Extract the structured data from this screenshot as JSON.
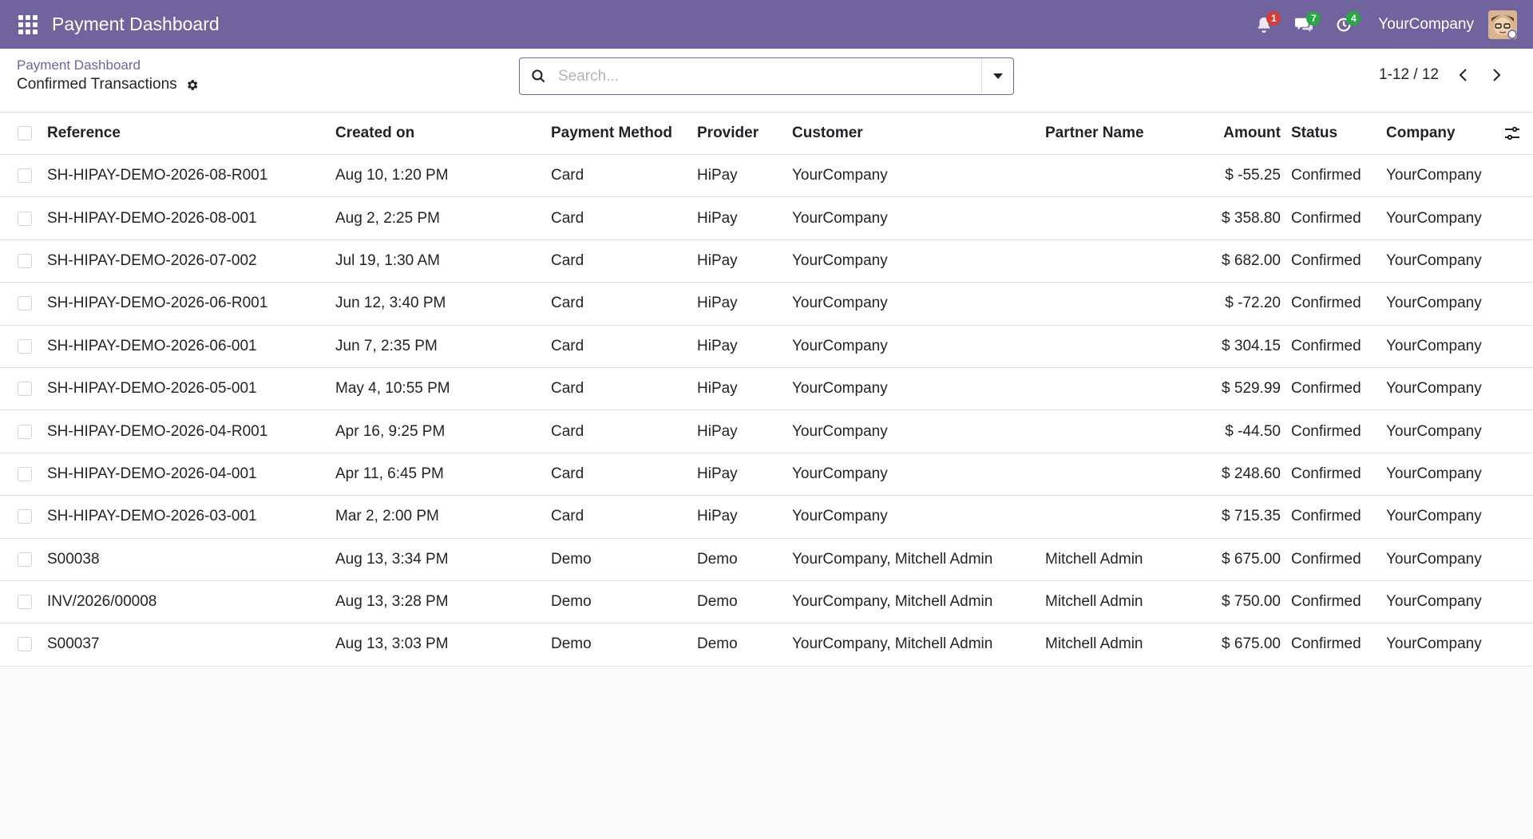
{
  "navbar": {
    "app_title": "Payment Dashboard",
    "notifications_count": "1",
    "messages_count": "7",
    "activities_count": "4",
    "company": "YourCompany"
  },
  "control_panel": {
    "breadcrumb": "Payment Dashboard",
    "title": "Confirmed Transactions",
    "search_placeholder": "Search...",
    "pager": "1-12 / 12"
  },
  "table": {
    "columns": {
      "reference": "Reference",
      "created_on": "Created on",
      "payment_method": "Payment Method",
      "provider": "Provider",
      "customer": "Customer",
      "partner_name": "Partner Name",
      "amount": "Amount",
      "status": "Status",
      "company": "Company"
    },
    "rows": [
      {
        "reference": "SH-HIPAY-DEMO-2026-08-R001",
        "created_on": "Aug 10, 1:20 PM",
        "payment_method": "Card",
        "provider": "HiPay",
        "customer": "YourCompany",
        "partner_name": "",
        "amount": "$ -55.25",
        "status": "Confirmed",
        "company": "YourCompany"
      },
      {
        "reference": "SH-HIPAY-DEMO-2026-08-001",
        "created_on": "Aug 2, 2:25 PM",
        "payment_method": "Card",
        "provider": "HiPay",
        "customer": "YourCompany",
        "partner_name": "",
        "amount": "$ 358.80",
        "status": "Confirmed",
        "company": "YourCompany"
      },
      {
        "reference": "SH-HIPAY-DEMO-2026-07-002",
        "created_on": "Jul 19, 1:30 AM",
        "payment_method": "Card",
        "provider": "HiPay",
        "customer": "YourCompany",
        "partner_name": "",
        "amount": "$ 682.00",
        "status": "Confirmed",
        "company": "YourCompany"
      },
      {
        "reference": "SH-HIPAY-DEMO-2026-06-R001",
        "created_on": "Jun 12, 3:40 PM",
        "payment_method": "Card",
        "provider": "HiPay",
        "customer": "YourCompany",
        "partner_name": "",
        "amount": "$ -72.20",
        "status": "Confirmed",
        "company": "YourCompany"
      },
      {
        "reference": "SH-HIPAY-DEMO-2026-06-001",
        "created_on": "Jun 7, 2:35 PM",
        "payment_method": "Card",
        "provider": "HiPay",
        "customer": "YourCompany",
        "partner_name": "",
        "amount": "$ 304.15",
        "status": "Confirmed",
        "company": "YourCompany"
      },
      {
        "reference": "SH-HIPAY-DEMO-2026-05-001",
        "created_on": "May 4, 10:55 PM",
        "payment_method": "Card",
        "provider": "HiPay",
        "customer": "YourCompany",
        "partner_name": "",
        "amount": "$ 529.99",
        "status": "Confirmed",
        "company": "YourCompany"
      },
      {
        "reference": "SH-HIPAY-DEMO-2026-04-R001",
        "created_on": "Apr 16, 9:25 PM",
        "payment_method": "Card",
        "provider": "HiPay",
        "customer": "YourCompany",
        "partner_name": "",
        "amount": "$ -44.50",
        "status": "Confirmed",
        "company": "YourCompany"
      },
      {
        "reference": "SH-HIPAY-DEMO-2026-04-001",
        "created_on": "Apr 11, 6:45 PM",
        "payment_method": "Card",
        "provider": "HiPay",
        "customer": "YourCompany",
        "partner_name": "",
        "amount": "$ 248.60",
        "status": "Confirmed",
        "company": "YourCompany"
      },
      {
        "reference": "SH-HIPAY-DEMO-2026-03-001",
        "created_on": "Mar 2, 2:00 PM",
        "payment_method": "Card",
        "provider": "HiPay",
        "customer": "YourCompany",
        "partner_name": "",
        "amount": "$ 715.35",
        "status": "Confirmed",
        "company": "YourCompany"
      },
      {
        "reference": "S00038",
        "created_on": "Aug 13, 3:34 PM",
        "payment_method": "Demo",
        "provider": "Demo",
        "customer": "YourCompany, Mitchell Admin",
        "partner_name": "Mitchell Admin",
        "amount": "$ 675.00",
        "status": "Confirmed",
        "company": "YourCompany"
      },
      {
        "reference": "INV/2026/00008",
        "created_on": "Aug 13, 3:28 PM",
        "payment_method": "Demo",
        "provider": "Demo",
        "customer": "YourCompany, Mitchell Admin",
        "partner_name": "Mitchell Admin",
        "amount": "$ 750.00",
        "status": "Confirmed",
        "company": "YourCompany"
      },
      {
        "reference": "S00037",
        "created_on": "Aug 13, 3:03 PM",
        "payment_method": "Demo",
        "provider": "Demo",
        "customer": "YourCompany, Mitchell Admin",
        "partner_name": "Mitchell Admin",
        "amount": "$ 675.00",
        "status": "Confirmed",
        "company": "YourCompany"
      }
    ]
  },
  "icons": {
    "apps": "apps-grid-icon",
    "bell": "bell-icon",
    "chat": "chat-icon",
    "activity": "clock-icon",
    "gear": "gear-icon",
    "search": "search-icon",
    "caret": "caret-down-icon",
    "optional_columns": "sliders-icon"
  },
  "colors": {
    "navbar": "#71639e",
    "badge_red": "#d23f3a",
    "badge_green": "#28a745"
  }
}
